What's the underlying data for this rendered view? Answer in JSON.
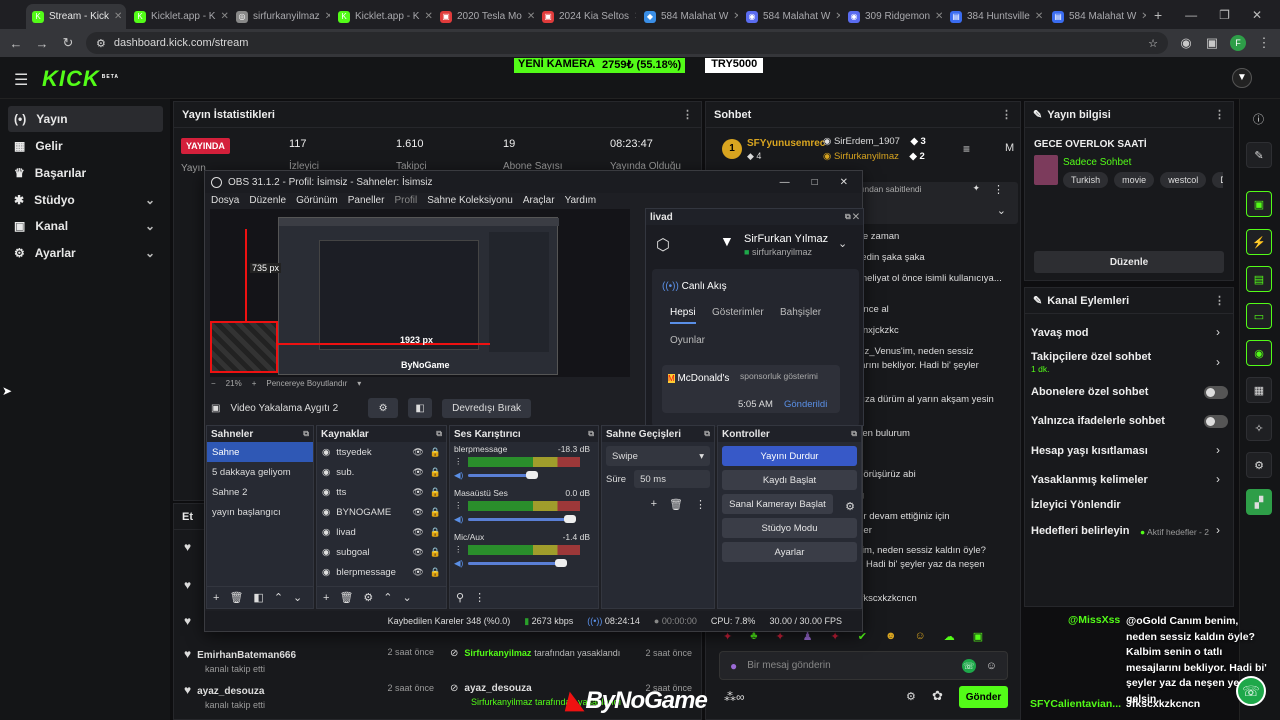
{
  "browser": {
    "tabs": [
      {
        "label": "Stream - Kick",
        "color": "#53fc18",
        "glyph": "K",
        "active": true
      },
      {
        "label": "Kicklet.app - K",
        "color": "#53fc18",
        "glyph": "K"
      },
      {
        "label": "sirfurkanyilmaz",
        "color": "#888888",
        "glyph": "◎"
      },
      {
        "label": "Kicklet.app - K",
        "color": "#53fc18",
        "glyph": "K"
      },
      {
        "label": "2020 Tesla Mo",
        "color": "#e03b3b",
        "glyph": "▣"
      },
      {
        "label": "2024 Kia Seltos",
        "color": "#e03b3b",
        "glyph": "▣"
      },
      {
        "label": "584 Malahat W",
        "color": "#3a8ee6",
        "glyph": "◆"
      },
      {
        "label": "584 Malahat W",
        "color": "#5a6cf0",
        "glyph": "◉"
      },
      {
        "label": "309 Ridgemon",
        "color": "#5a6cf0",
        "glyph": "◉"
      },
      {
        "label": "384 Huntsville",
        "color": "#3a6cf0",
        "glyph": "▤"
      },
      {
        "label": "584 Malahat W",
        "color": "#3a6cf0",
        "glyph": "▤"
      }
    ],
    "url": "dashboard.kick.com/stream",
    "profile_initial": "F"
  },
  "ticker": {
    "label": "YENİ KAMERA",
    "amount": "2759₺ (55.18%)",
    "goal": "TRY5000"
  },
  "logo": "KICK",
  "logo_sup": "BETA",
  "sidebar": {
    "items": [
      {
        "label": "Yayın",
        "icon": "(•)"
      },
      {
        "label": "Gelir",
        "icon": "▦"
      },
      {
        "label": "Başarılar",
        "icon": "♛"
      },
      {
        "label": "Stüdyo",
        "icon": "✱"
      },
      {
        "label": "Kanal",
        "icon": "▣"
      },
      {
        "label": "Ayarlar",
        "icon": "⚙"
      }
    ]
  },
  "stats": {
    "title": "Yayın İstatistikleri",
    "badge": "YAYINDA",
    "viewers": "117",
    "viewers_label": "İzleyici",
    "followers": "1.610",
    "followers_label": "Takipçi",
    "subs": "19",
    "subs_label": "Abone Sayısı",
    "uptime": "08:23:47",
    "uptime_label": "Yayında Olduğu",
    "behind": "Yayın"
  },
  "chat": {
    "title": "Sohbet",
    "leader1": "SFYyunusemrec",
    "leader1_count": "4",
    "leader2": "SirErdem_1907",
    "leader2_count": "3",
    "leader3": "Sirfurkanyilmaz",
    "leader3_count": "2",
    "pinned_note": "ından sabitlendi",
    "messages": [
      "s: Ne zaman",
      "... yedin şaka şaka",
      "a ameliyat ol önce isimli kullanıcıya...",
      "s: Önce al",
      "s: Cnxjckzkc",
      "nım z_Venus'im, neden sessiz",
      "sajlarını bekliyor. Hadi bi' şeyler",
      "s: Kıza dürüm al yarın akşam yesin",
      "s: Ben bulurum",
      "s: Görüşürüz abi",
      "s: İg",
      "eyler devam ettiğiniz için",
      "eyirler",
      "benim, neden sessiz kaldın öyle?",
      "iyor. Hadi bi' şeyler yaz da neşen",
      "s: Jfkscxkzkcncn"
    ],
    "input_placeholder": "Bir mesaj gönderin",
    "send": "Gönder"
  },
  "stream_info": {
    "title": "Yayın bilgisi",
    "stream_title": "GECE OVERLOK SAATİ",
    "category": "Sadece Sohbet",
    "tags": [
      "Turkish",
      "movie",
      "westcol",
      "DIEALI"
    ],
    "edit": "Düzenle"
  },
  "channel_actions": {
    "title": "Kanal Eylemleri",
    "slow": "Yavaş mod",
    "followers_only": "Takipçilere özel sohbet",
    "followers_only_sub": "1 dk.",
    "subs_only": "Abonelere özel sohbet",
    "emote_only": "Yalnızca ifadelerle sohbet",
    "age": "Hesap yaşı kısıtlaması",
    "banned_words": "Yasaklanmış kelimeler",
    "redirect": "İzleyici Yönlendir",
    "goals": "Hedefleri belirleyin",
    "goals_sub": "Aktif hedefler - 2"
  },
  "overlay_chat": {
    "user": "@MissXss",
    "text": "@oGold Canım benim, neden sessiz kaldın öyle? Kalbim senin o tatlı mesajlarını bekliyor. Hadi bi' şeyler yaz da neşen yerine gelsin.",
    "user2": "SFYCalientavian...",
    "text2": "Jfkscxkzkcncn"
  },
  "events": {
    "title": "Et",
    "rows": [
      {
        "name": "EmirhanBateman666",
        "sub": "kanalı takip etti",
        "time": "2 saat önce"
      },
      {
        "name": "ayaz_desouza",
        "sub": "kanalı takip etti",
        "time": "2 saat önce"
      }
    ],
    "mod_rows": [
      {
        "name": "Sirfurkanyilmaz",
        "sub": "tarafından yasaklandı",
        "time": "2 saat önce"
      },
      {
        "name": "ayaz_desouza",
        "sub": "Sirfurkanyilmaz tarafından yasaklandı",
        "time": "2 saat önce"
      }
    ]
  },
  "obs": {
    "title": "OBS 31.1.2 - Profil: İsimsiz - Sahneler: İsimsiz",
    "menu": [
      "Dosya",
      "Düzenle",
      "Görünüm",
      "Paneller",
      "Profil",
      "Sahne Koleksiyonu",
      "Araçlar",
      "Yardım"
    ],
    "dim1": "735 px",
    "dim2": "1923 px",
    "zoom": "21%",
    "fit": "Pencereye Boyutlandır",
    "source_bar": "Video Yakalama Aygıtı 2",
    "deactivate": "Devredışı Bırak",
    "scenes_title": "Sahneler",
    "scenes": [
      "Sahne",
      "5 dakkaya geliyom",
      "Sahne 2",
      "yayın başlangıcı"
    ],
    "sources_title": "Kaynaklar",
    "sources": [
      "ttsyedek",
      "sub.",
      "tts",
      "BYNOGAME",
      "livad",
      "subgoal",
      "blerpmessage"
    ],
    "mixer_title": "Ses Karıştırıcı",
    "mixer": [
      {
        "name": "blerpmessage",
        "db": "-18.3 dB",
        "level": 0.62
      },
      {
        "name": "Masaüstü Ses",
        "db": "0.0 dB",
        "level": 0.96
      },
      {
        "name": "Mic/Aux",
        "db": "-1.4 dB",
        "level": 0.88
      }
    ],
    "transitions_title": "Sahne Geçişleri",
    "transition": "Swipe",
    "duration_label": "Süre",
    "duration": "50 ms",
    "controls_title": "Kontroller",
    "controls": [
      "Yayını Durdur",
      "Kaydı Başlat",
      "Sanal Kamerayı Başlat",
      "Stüdyo Modu",
      "Ayarlar"
    ],
    "livad": {
      "title": "livad",
      "user": "SirFurkan Yılmaz",
      "handle": "sirfurkanyilmaz",
      "live": "Canlı Akış",
      "tabs": [
        "Hepsi",
        "Gösterimler",
        "Bahşişler",
        "Oyunlar"
      ],
      "sponsor": "McDonald's",
      "sponsor_note": "sponsorluk gösterimi",
      "time": "5:05 AM",
      "sent": "Gönderildi"
    },
    "status": {
      "dropped": "Kaybedilen Kareler 348 (%0.0)",
      "kbps": "2673 kbps",
      "live_time": "08:24:14",
      "rec_time": "00:00:00",
      "cpu": "CPU: 7.8%",
      "fps": "30.00 / 30.00 FPS"
    }
  },
  "watermark": "ByNoGame"
}
